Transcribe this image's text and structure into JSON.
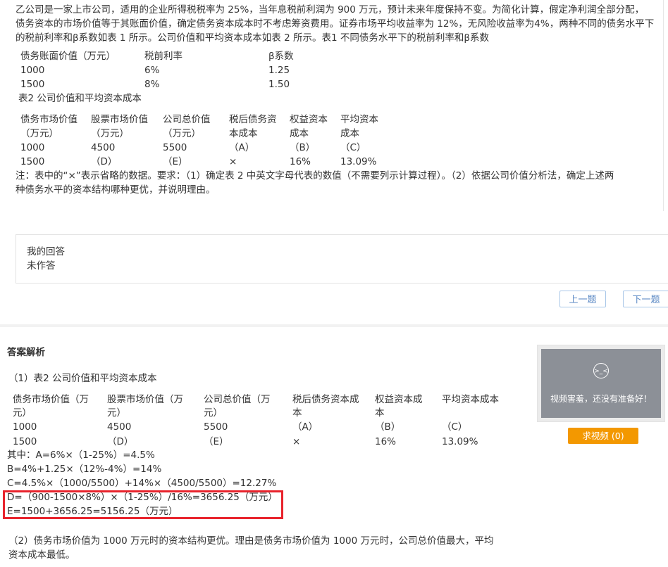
{
  "question": {
    "lines": [
      "乙公司是一家上市公司，适用的企业所得税税率为 25%，当年息税前利润为 900 万元，预计未来年度保持不变。为简化计算，假定净利润全部分配，",
      "债务资本的市场价值等于其账面价值，确定债务资本成本时不考虑筹资费用。证券市场平均收益率为 12%，无风险收益率为4%，两种不同的债务水平下",
      "的税前利率和β系数如表 1 所示。公司价值和平均资本成本如表 2 所示。表1                不同债务水平下的税前利率和β系数"
    ],
    "table1": {
      "headers": [
        "债务账面价值（万元）",
        "税前利率",
        "β系数"
      ],
      "rows": [
        [
          "1000",
          "6%",
          "1.25"
        ],
        [
          "1500",
          "8%",
          "1.50"
        ]
      ]
    },
    "table2_caption": "表2                          公司价值和平均资本成本",
    "table2": {
      "headers_line1": [
        "债务市场价值",
        "股票市场价值",
        "公司总价值",
        "税后债务资",
        "权益资本",
        "平均资本"
      ],
      "headers_line2": [
        "（万元）",
        "（万元）",
        "（万元）",
        "本成本",
        "成本",
        "成本"
      ],
      "rows": [
        [
          "1000",
          "4500",
          "5500",
          "（A）",
          "（B）",
          "（C）"
        ],
        [
          "1500",
          "（D）",
          "（E）",
          "×",
          "16%",
          "13.09%"
        ]
      ]
    },
    "note_lines": [
      "注：表中的“×”表示省略的数据。要求：（1）确定表 2 中英文字母代表的数值（不需要列示计算过程）。（2）依据公司价值分析法，确定上述两",
      "种债务水平的资本结构哪种更优，并说明理由。"
    ]
  },
  "my_answer": {
    "label": "我的回答",
    "value": "未作答"
  },
  "nav": {
    "prev": "上一题",
    "next": "下一题"
  },
  "analysis": {
    "title": "答案解析",
    "caption": "（1）表2                  公司价值和平均资本成本",
    "table": {
      "headers": [
        [
          "债务市场价值（万",
          "元）"
        ],
        [
          "股票市场价值（万",
          "元）"
        ],
        [
          "公司总价值（万",
          "元）"
        ],
        [
          "税后债务资本成",
          "本"
        ],
        [
          "权益资本成",
          "本"
        ],
        [
          "平均资本成本",
          ""
        ]
      ],
      "rows": [
        [
          "1000",
          "4500",
          "5500",
          "（A）",
          "（B）",
          "（C）"
        ],
        [
          "1500",
          "（D）",
          "（E）",
          "×",
          "16%",
          "13.09%"
        ]
      ]
    },
    "calc": [
      "其中：A=6%×（1-25%）=4.5%",
      "B=4%+1.25×（12%-4%）=14%",
      "C=4.5%×（1000/5500）+14%×（4500/5500）=12.27%",
      "D=（900-1500×8%）×（1-25%）/16%=3656.25（万元）",
      "E=1500+3656.25=5156.25（万元）"
    ],
    "conclusion": [
      "（2）债务市场价值为 1000 万元时的资本结构更优。理由是债务市场价值为 1000 万元时，公司总价值最大，平均",
      "资本成本最低。"
    ]
  },
  "video": {
    "face": ">_<",
    "message": "视频害羞，还没有准备好！",
    "request_label": "求视频 (0)"
  },
  "colors": {
    "highlight": "#e8232c",
    "request_button": "#f39800",
    "nav_border": "#a9c7e8"
  }
}
